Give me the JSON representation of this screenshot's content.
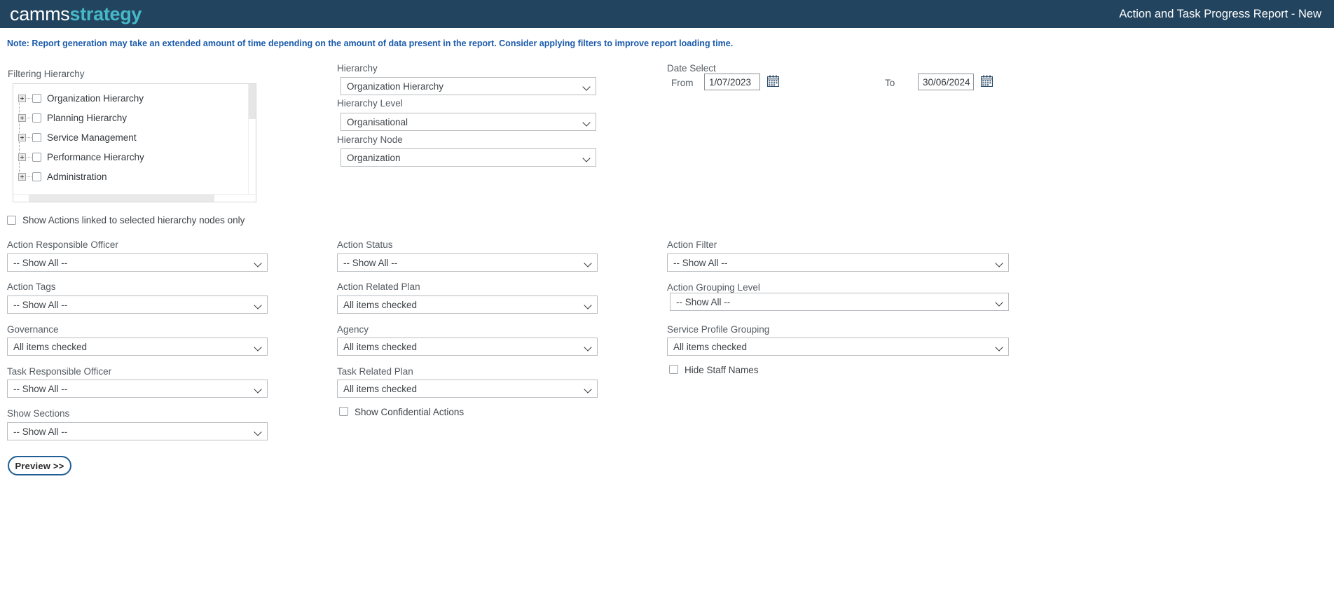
{
  "header": {
    "logo_primary": "camms",
    "logo_accent": "strategy",
    "title": "Action and Task Progress Report - New",
    "bg_color": "#22445e",
    "accent_color": "#46b8c8"
  },
  "note": {
    "text": "Note: Report generation may take an extended amount of time depending on the amount of data present in the report. Consider applying filters to improve report loading time.",
    "color": "#1a5aab"
  },
  "filtering_hierarchy": {
    "label": "Filtering Hierarchy",
    "nodes": [
      {
        "label": "Organization Hierarchy",
        "expanded": false,
        "checked": false
      },
      {
        "label": "Planning Hierarchy",
        "expanded": false,
        "checked": false
      },
      {
        "label": "Service Management",
        "expanded": false,
        "checked": false
      },
      {
        "label": "Performance Hierarchy",
        "expanded": false,
        "checked": false
      },
      {
        "label": "Administration",
        "expanded": false,
        "checked": false
      }
    ],
    "linked_only": {
      "label": "Show Actions linked to selected hierarchy nodes only",
      "checked": false
    }
  },
  "hierarchy": {
    "hierarchy_label": "Hierarchy",
    "hierarchy_value": "Organization Hierarchy",
    "level_label": "Hierarchy Level",
    "level_value": "Organisational",
    "node_label": "Hierarchy Node",
    "node_value": "Organization"
  },
  "date_select": {
    "label": "Date Select",
    "from_label": "From",
    "from_value": "1/07/2023",
    "to_label": "To",
    "to_value": "30/06/2024",
    "from_icon": "calendar-icon",
    "to_icon": "calendar-icon"
  },
  "filters": {
    "action_responsible_officer": {
      "label": "Action Responsible Officer",
      "value": "-- Show All --"
    },
    "action_status": {
      "label": "Action Status",
      "value": "-- Show All --"
    },
    "action_filter": {
      "label": "Action Filter",
      "value": "-- Show All --"
    },
    "action_tags": {
      "label": "Action Tags",
      "value": "-- Show All --"
    },
    "action_related_plan": {
      "label": "Action Related Plan",
      "value": "All items checked"
    },
    "action_grouping_level": {
      "label": "Action Grouping Level",
      "value": "-- Show All --"
    },
    "governance": {
      "label": "Governance",
      "value": "All items checked"
    },
    "agency": {
      "label": "Agency",
      "value": "All items checked"
    },
    "service_profile_grouping": {
      "label": "Service Profile Grouping",
      "value": "All items checked"
    },
    "task_responsible_officer": {
      "label": "Task Responsible Officer",
      "value": "-- Show All --"
    },
    "task_related_plan": {
      "label": "Task Related Plan",
      "value": "All items checked"
    },
    "hide_staff_names": {
      "label": "Hide Staff Names",
      "checked": false
    },
    "show_sections": {
      "label": "Show Sections",
      "value": "-- Show All --"
    },
    "show_confidential_actions": {
      "label": "Show Confidential Actions",
      "checked": false
    }
  },
  "actions": {
    "preview_label": "Preview >>"
  }
}
